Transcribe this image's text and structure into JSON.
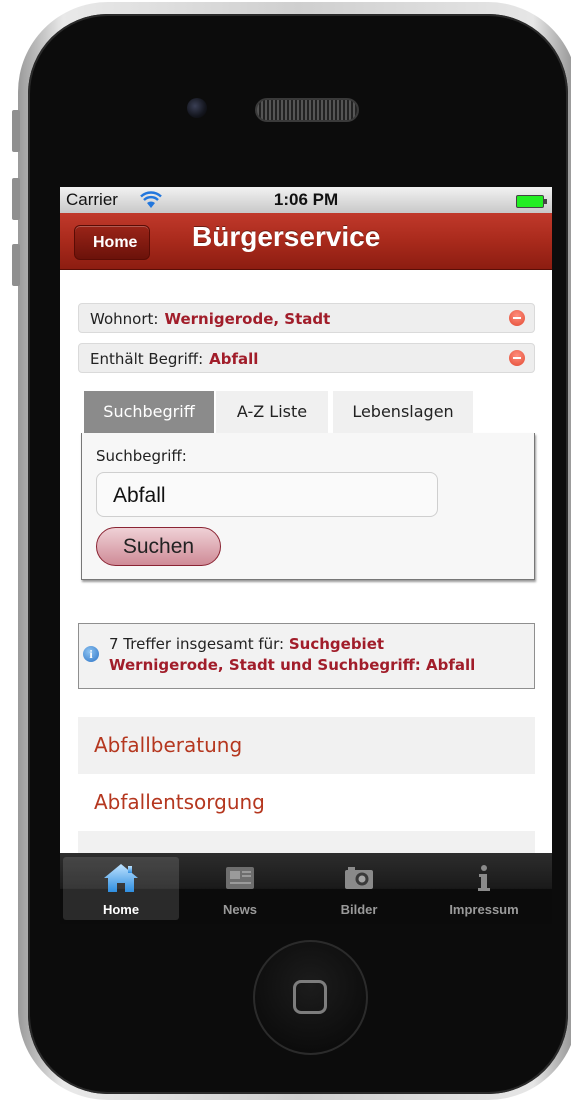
{
  "status_bar": {
    "carrier": "Carrier",
    "time": "1:06 PM"
  },
  "nav": {
    "back_label": "Home",
    "title": "Bürgerservice"
  },
  "filters": [
    {
      "label": "Wohnort:",
      "value": "Wernigerode, Stadt"
    },
    {
      "label": "Enthält Begriff:",
      "value": "Abfall"
    }
  ],
  "tabs": [
    {
      "label": "Suchbegriff",
      "active": true
    },
    {
      "label": "A-Z Liste",
      "active": false
    },
    {
      "label": "Lebenslagen",
      "active": false
    }
  ],
  "search": {
    "label": "Suchbegriff:",
    "value": "Abfall",
    "button": "Suchen"
  },
  "info": {
    "prefix": "7 Treffer insgesamt für: ",
    "highlight_1": "Suchgebiet",
    "line2_a": "Wernigerode, Stadt",
    "line2_mid": " und ",
    "line2_b": "Suchbegriff: Abfall"
  },
  "results": [
    "Abfallberatung",
    "Abfallentsorgung"
  ],
  "tabbar": [
    {
      "label": "Home",
      "icon": "home-icon",
      "active": true
    },
    {
      "label": "News",
      "icon": "news-icon",
      "active": false
    },
    {
      "label": "Bilder",
      "icon": "camera-icon",
      "active": false
    },
    {
      "label": "Impressum",
      "icon": "info-icon",
      "active": false
    }
  ],
  "colors": {
    "accent": "#a11d2a",
    "navbar": "#a92a1c",
    "result_link": "#b5371f"
  }
}
